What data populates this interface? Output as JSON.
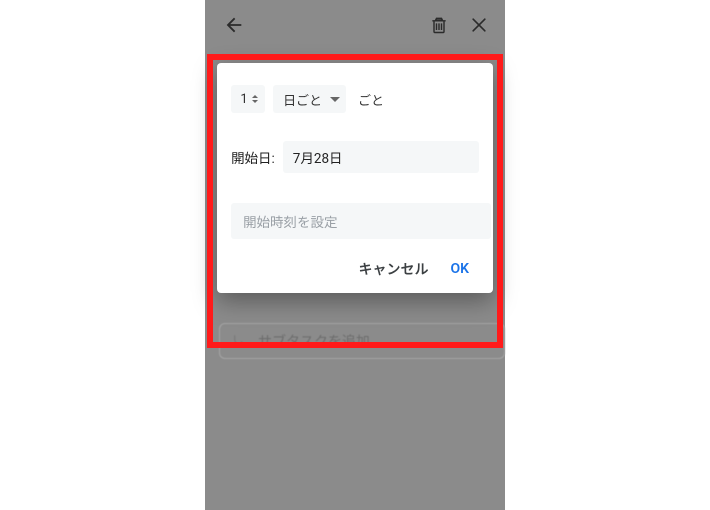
{
  "appbar": {
    "back_icon": "back-arrow",
    "delete_icon": "trash",
    "close_icon": "close"
  },
  "dialog": {
    "interval": {
      "count": "1",
      "unit": "日ごと",
      "suffix": "ごと"
    },
    "start_date_label": "開始日:",
    "start_date_value": "7月28日",
    "start_time_placeholder": "開始時刻を設定",
    "buttons": {
      "cancel": "キャンセル",
      "ok": "OK"
    }
  },
  "background": {
    "add_subtask_hint": "サブタスクを追加"
  },
  "colors": {
    "highlight": "#ff1a1a",
    "overlay_bg": "#8b8b8b",
    "link": "#1a73e8"
  }
}
